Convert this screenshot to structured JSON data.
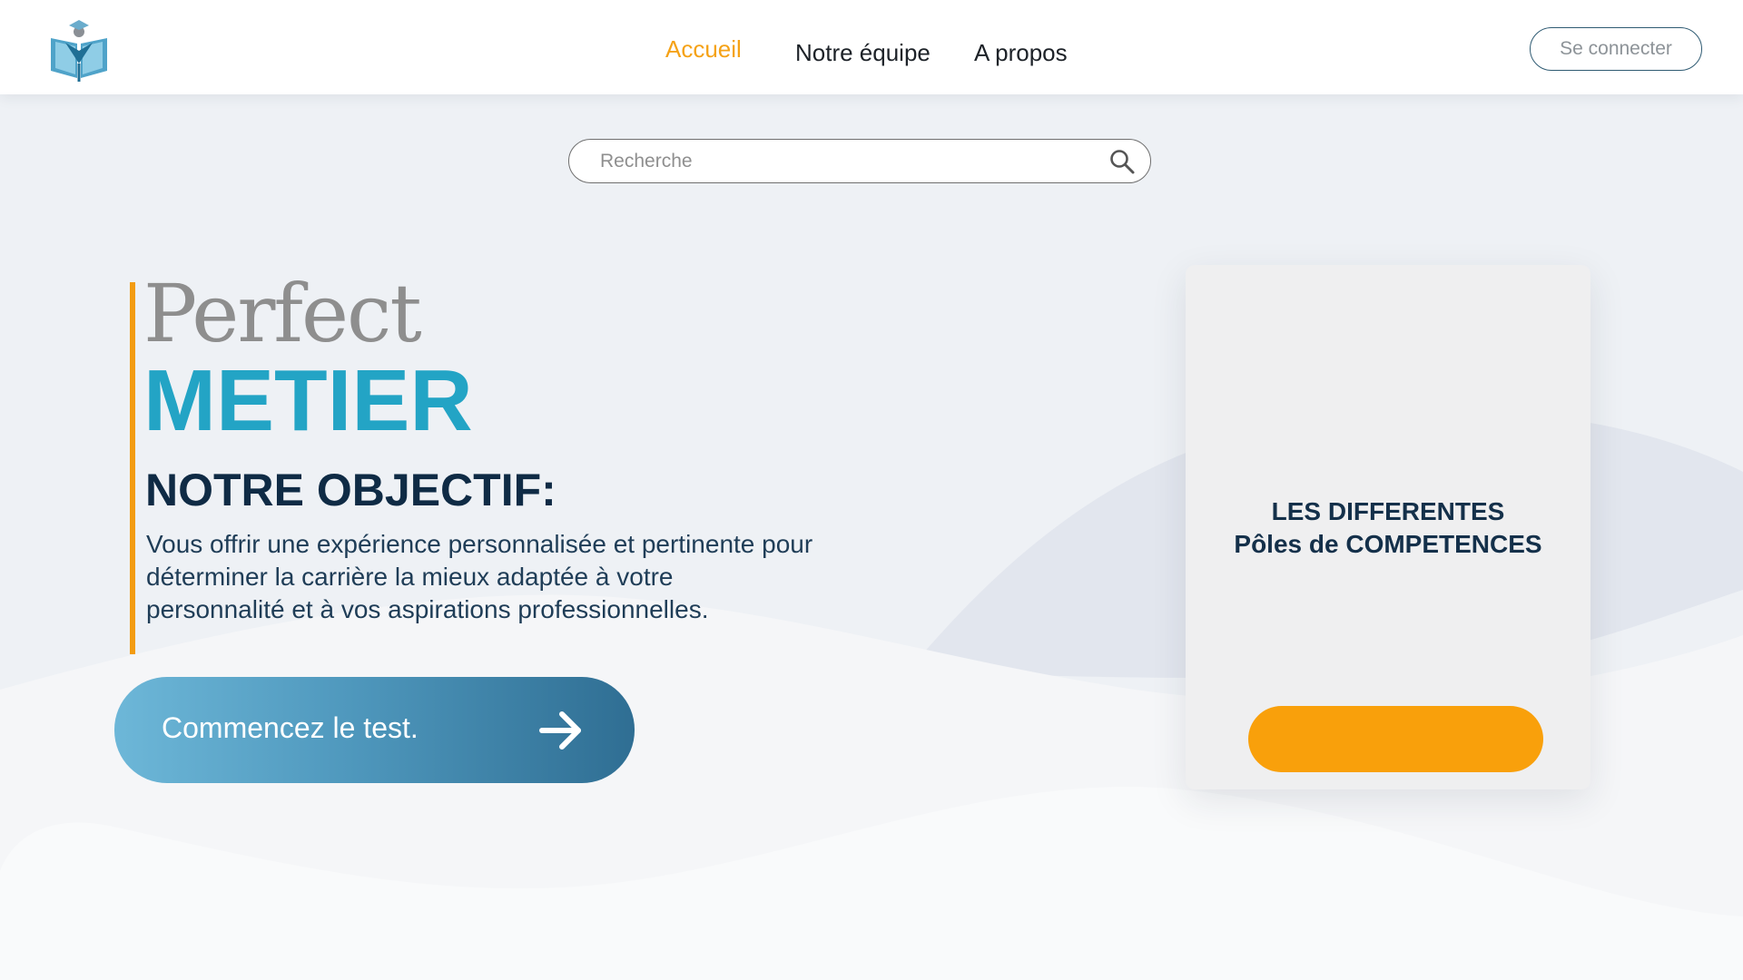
{
  "app": {
    "logo_icon": "graduation-book-logo"
  },
  "nav": {
    "items": [
      {
        "label": "Accueil",
        "active": true
      },
      {
        "label": "Notre équipe",
        "active": false
      },
      {
        "label": "A propos",
        "active": false
      }
    ],
    "login_label": "Se connecter"
  },
  "search": {
    "placeholder": "Recherche",
    "value": "",
    "icon": "search-icon"
  },
  "hero": {
    "title_script": "Perfect",
    "title_main": "METIER",
    "objective_heading": "NOTRE OBJECTIF:",
    "objective_text": "Vous offrir une expérience personnalisée et pertinente pour déterminer la carrière la mieux adaptée à votre personnalité et à vos aspirations professionnelles.",
    "cta_label": "Commencez le test.",
    "cta_icon": "arrow-right-icon"
  },
  "card": {
    "title_line1": "LES DIFFERENTES",
    "title_line2": "Pôles de COMPETENCES",
    "button_label": ""
  },
  "colors": {
    "accent_orange": "#f5a216",
    "brand_blue": "#23a4c5",
    "navy": "#0f2b45",
    "cta_gradient_start": "#6db7d8",
    "cta_gradient_end": "#2f6e93",
    "card_button": "#f9a00b"
  }
}
